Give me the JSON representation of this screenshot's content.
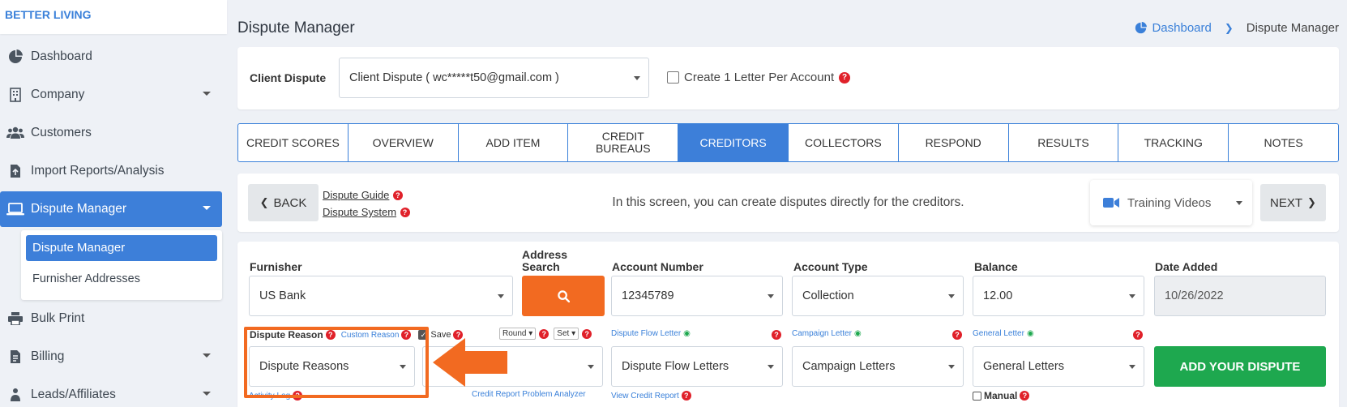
{
  "brand": "BETTER LIVING",
  "sidebar": {
    "items": [
      {
        "label": "Dashboard",
        "icon": "dashboard-icon"
      },
      {
        "label": "Company",
        "icon": "building-icon"
      },
      {
        "label": "Customers",
        "icon": "users-icon"
      },
      {
        "label": "Import Reports/Analysis",
        "icon": "import-icon"
      },
      {
        "label": "Dispute Manager",
        "icon": "laptop-icon"
      },
      {
        "label": "Bulk Print",
        "icon": "print-icon"
      },
      {
        "label": "Billing",
        "icon": "invoice-icon"
      },
      {
        "label": "Leads/Affiliates",
        "icon": "leads-icon"
      }
    ],
    "submenu": [
      "Dispute Manager",
      "Furnisher Addresses"
    ]
  },
  "header": {
    "title": "Dispute Manager",
    "breadcrumb": {
      "home": "Dashboard",
      "current": "Dispute Manager"
    }
  },
  "client": {
    "label": "Client Dispute",
    "value": "Client Dispute ( wc*****t50@gmail.com )",
    "checkbox_label": "Create 1 Letter Per Account"
  },
  "tabs": [
    {
      "line1": "CREDIT SCORES",
      "line2": ""
    },
    {
      "line1": "OVERVIEW",
      "line2": ""
    },
    {
      "line1": "ADD ITEM",
      "line2": ""
    },
    {
      "line1": "CREDIT",
      "line2": "BUREAUS"
    },
    {
      "line1": "CREDITORS",
      "line2": ""
    },
    {
      "line1": "COLLECTORS",
      "line2": ""
    },
    {
      "line1": "RESPOND",
      "line2": ""
    },
    {
      "line1": "RESULTS",
      "line2": ""
    },
    {
      "line1": "TRACKING",
      "line2": ""
    },
    {
      "line1": "NOTES",
      "line2": ""
    }
  ],
  "nav": {
    "back": "BACK",
    "guide": "Dispute Guide",
    "system": "Dispute System",
    "info": "In this screen, you can create disputes directly for the creditors.",
    "training": "Training Videos",
    "next": "NEXT"
  },
  "form": {
    "furnisher_label": "Furnisher",
    "furnisher_value": "US Bank",
    "address_label_1": "Address",
    "address_label_2": "Search",
    "account_number_label": "Account Number",
    "account_number_value": "12345789",
    "account_type_label": "Account Type",
    "account_type_value": "Collection",
    "balance_label": "Balance",
    "balance_value": "12.00",
    "date_added_label": "Date Added",
    "date_added_value": "10/26/2022",
    "dispute_reason_label": "Dispute Reason",
    "custom_reason": "Custom Reason",
    "save": "Save",
    "round": "Round",
    "set": "Set",
    "dispute_reason_value": "Dispute Reasons",
    "activity_log": "Activity Log",
    "credit_problem_analyzer": "Credit Report Problem Analyzer",
    "dispute_flow_label": "Dispute Flow Letter",
    "dispute_flow_value": "Dispute Flow Letters",
    "view_credit_report": "View Credit Report",
    "campaign_label": "Campaign Letter",
    "campaign_value": "Campaign Letters",
    "general_label": "General Letter",
    "general_value": "General Letters",
    "manual": "Manual",
    "add_dispute": "ADD YOUR DISPUTE"
  },
  "colors": {
    "primary": "#3d7fd9",
    "orange": "#f26a21",
    "green": "#1ea84f",
    "red": "#e0212a"
  }
}
